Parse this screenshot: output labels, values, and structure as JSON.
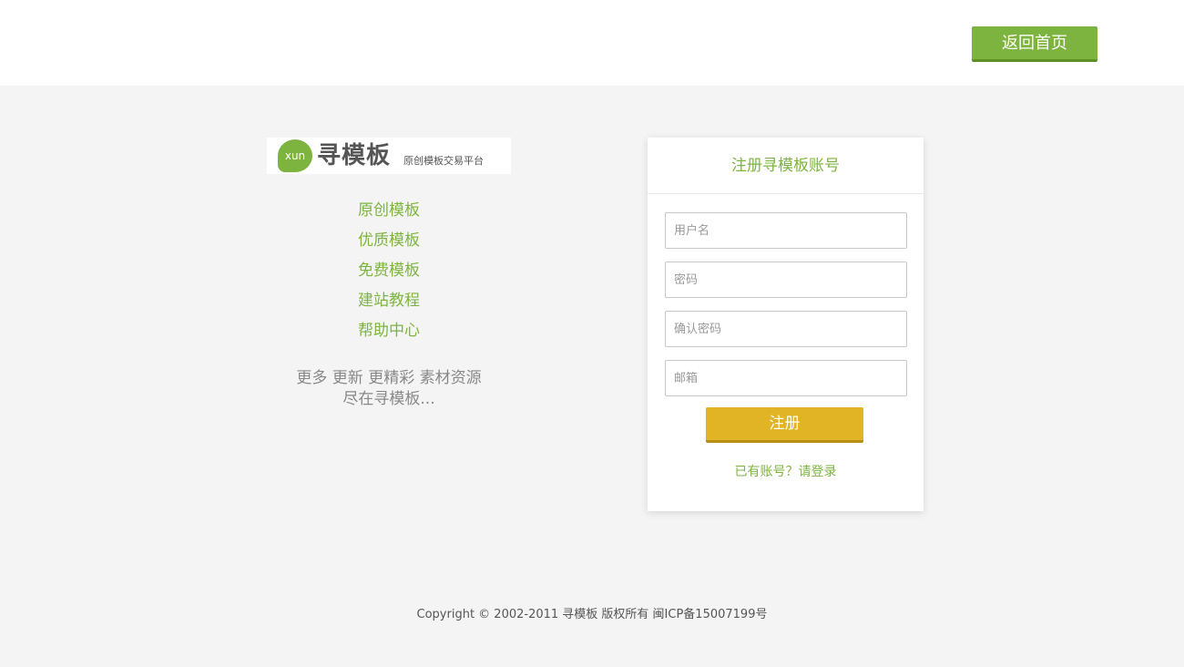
{
  "header": {
    "home_button": "返回首页"
  },
  "brand": {
    "bubble_text": "xun",
    "name": "寻模板",
    "tagline": "原创模板交易平台"
  },
  "nav": {
    "items": [
      {
        "label": "原创模板"
      },
      {
        "label": "优质模板"
      },
      {
        "label": "免费模板"
      },
      {
        "label": "建站教程"
      },
      {
        "label": "帮助中心"
      }
    ]
  },
  "slogan": {
    "line1": "更多 更新 更精彩 素材资源",
    "line2": "尽在寻模板..."
  },
  "register": {
    "title": "注册寻模板账号",
    "username_placeholder": "用户名",
    "password_placeholder": "密码",
    "confirm_placeholder": "确认密码",
    "email_placeholder": "邮箱",
    "submit_label": "注册",
    "login_link": "已有账号？请登录"
  },
  "footer": {
    "copyright": "Copyright © 2002-2011 寻模板 版权所有 闽ICP备15007199号"
  },
  "colors": {
    "accent_green": "#7db43f",
    "button_yellow": "#e0b424",
    "background": "#f4f4f4"
  }
}
